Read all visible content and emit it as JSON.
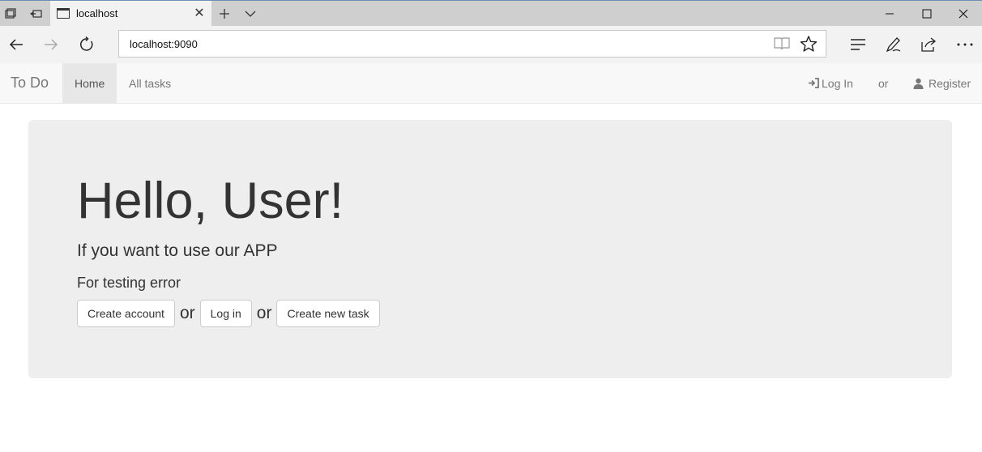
{
  "browser": {
    "tab_title": "localhost",
    "url": "localhost:9090"
  },
  "navbar": {
    "brand": "To Do",
    "items": [
      {
        "label": "Home",
        "active": true
      },
      {
        "label": "All tasks",
        "active": false
      }
    ],
    "right": {
      "login_label": "Log In",
      "or_label": "or",
      "register_label": "Register"
    }
  },
  "jumbotron": {
    "heading": "Hello, User!",
    "lead": "If you want to use our APP",
    "subtext": "For testing error",
    "buttons": {
      "create_account": "Create account",
      "log_in": "Log in",
      "create_task": "Create new task"
    },
    "separator": "or"
  },
  "colors": {
    "jumbotron_bg": "#eeeeee",
    "navbar_bg": "#f8f8f8",
    "text": "#333333",
    "nav_text": "#777777"
  }
}
